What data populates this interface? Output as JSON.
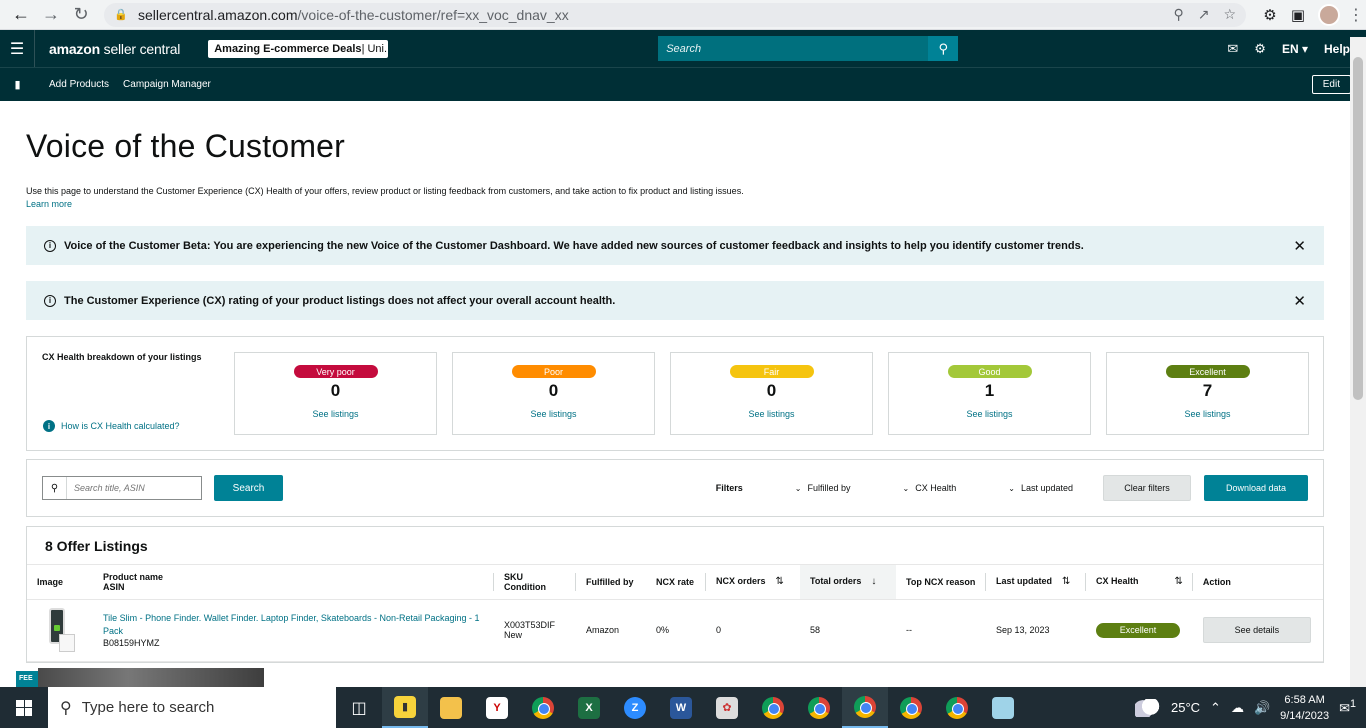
{
  "browser": {
    "url_domain": "sellercentral.amazon.com",
    "url_path": "/voice-of-the-customer/ref=xx_voc_dnav_xx"
  },
  "topbar": {
    "logo_brand": "amazon",
    "logo_suffix": "seller central",
    "store_name": "Amazing E-commerce Deals",
    "store_region": " | Uni...",
    "search_placeholder": "Search",
    "language": "EN",
    "help": "Help"
  },
  "bookmarks": {
    "items": [
      "Add Products",
      "Campaign Manager"
    ],
    "edit": "Edit"
  },
  "page": {
    "title": "Voice of the Customer",
    "intro": "Use this page to understand the Customer Experience (CX) Health of your offers, review product or listing feedback from customers, and take action to fix product and listing issues.",
    "learn_more": "Learn more",
    "banner_beta": "Voice of the Customer Beta: You are experiencing the new Voice of the Customer Dashboard. We have added new sources of customer feedback and insights to help you identify customer trends.",
    "banner_cx": "The Customer Experience (CX) rating of your product listings does not affect your overall account health."
  },
  "health": {
    "title": "CX Health breakdown of your listings",
    "how_link": "How is CX Health calculated?",
    "see_label": "See listings",
    "cards": [
      {
        "label": "Very poor",
        "count": "0",
        "color": "#c40b3d"
      },
      {
        "label": "Poor",
        "count": "0",
        "color": "#ff8c00"
      },
      {
        "label": "Fair",
        "count": "0",
        "color": "#f5c40f"
      },
      {
        "label": "Good",
        "count": "1",
        "color": "#a3c839"
      },
      {
        "label": "Excellent",
        "count": "7",
        "color": "#5d7f12"
      }
    ]
  },
  "filters": {
    "search_placeholder": "Search title, ASIN",
    "search_button": "Search",
    "label": "Filters",
    "fulfilled_by": "Fulfilled by",
    "cx_health": "CX Health",
    "last_updated": "Last updated",
    "clear": "Clear filters",
    "download": "Download data"
  },
  "listings": {
    "title": "8 Offer Listings",
    "columns": {
      "image": "Image",
      "product_name": "Product name",
      "asin": "ASIN",
      "sku": "SKU",
      "condition": "Condition",
      "fulfilled_by": "Fulfilled by",
      "ncx_rate": "NCX rate",
      "ncx_orders": "NCX orders",
      "total_orders": "Total orders",
      "top_reason": "Top NCX reason",
      "last_updated": "Last updated",
      "cx_health": "CX Health",
      "action": "Action"
    },
    "rows": [
      {
        "name": "Tile Slim - Phone Finder. Wallet Finder. Laptop Finder, Skateboards - Non-Retail Packaging - 1 Pack",
        "asin": "B08159HYMZ",
        "sku": "X003T53DIF",
        "condition": "New",
        "fulfilled_by": "Amazon",
        "ncx_rate": "0%",
        "ncx_orders": "0",
        "total_orders": "58",
        "top_reason": "--",
        "last_updated": "Sep 13, 2023",
        "cx_health": "Excellent",
        "action": "See details"
      }
    ]
  },
  "taskbar": {
    "search_placeholder": "Type here to search",
    "temperature": "25°C",
    "time": "6:58 AM",
    "date": "9/14/2023",
    "notifications": "1"
  },
  "misc": {
    "feedback_label": "FEE"
  }
}
